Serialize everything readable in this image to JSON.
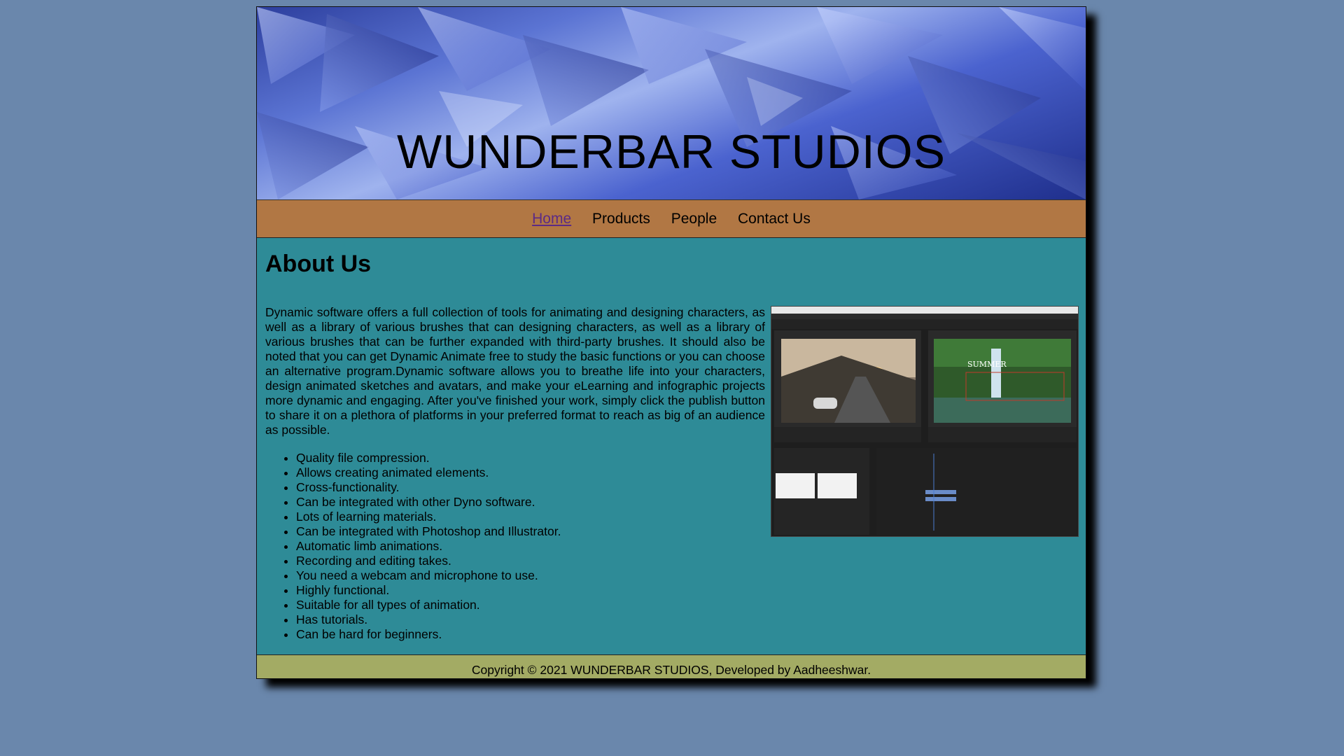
{
  "site": {
    "title": "WUNDERBAR STUDIOS"
  },
  "nav": {
    "items": [
      {
        "label": "Home",
        "active": true
      },
      {
        "label": "Products",
        "active": false
      },
      {
        "label": "People",
        "active": false
      },
      {
        "label": "Contact Us",
        "active": false
      }
    ]
  },
  "main": {
    "heading": "About Us",
    "intro": "Dynamic software offers a full collection of tools for animating and designing characters, as well as a library of various brushes that can designing characters, as well as a library of various brushes that can be further expanded with third-party brushes. It should also be noted that you can get Dynamic Animate free to study the basic functions or you can choose an alternative program.Dynamic software allows you to breathe life into your characters, design animated sketches and avatars, and make your eLearning and infographic projects more dynamic and engaging. After you've finished your work, simply click the publish button to share it on a plethora of platforms in your preferred format to reach as big of an audience as possible.",
    "features": [
      "Quality file compression.",
      "Allows creating animated elements.",
      "Cross-functionality.",
      "Can be integrated with other Dyno software.",
      "Lots of learning materials.",
      "Can be integrated with Photoshop and Illustrator.",
      "Automatic limb animations.",
      "Recording and editing takes.",
      "You need a webcam and microphone to use.",
      "Highly functional.",
      "Suitable for all types of animation.",
      "Has tutorials.",
      "Can be hard for beginners."
    ],
    "screenshot_overlay_text": "SUMMER"
  },
  "footer": {
    "text": "Copyright © 2021 WUNDERBAR STUDIOS, Developed by Aadheeshwar."
  },
  "colors": {
    "background": "#6a87ac",
    "nav": "#b17744",
    "main": "#2e8b97",
    "footer": "#a3ab64",
    "active_link": "#5b2a86"
  }
}
